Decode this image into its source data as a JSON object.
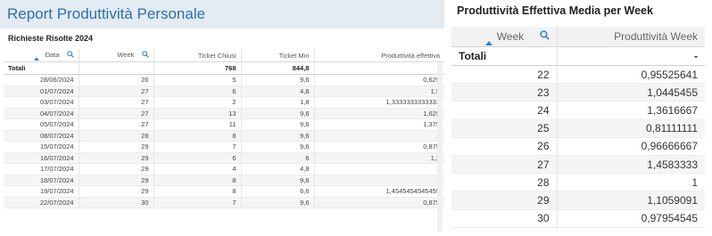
{
  "left_report": {
    "title": "Report Produttività Personale",
    "subtitle": "Richieste Risolte 2024",
    "columns": [
      "Data",
      "Week",
      "Ticket Chiusi",
      "Ticket Min",
      "Produttività effettiva"
    ],
    "totals": {
      "label": "Totali",
      "week": "",
      "ticket_chiusi": "768",
      "ticket_min": "844,8",
      "produttivita": "-"
    },
    "rows": [
      [
        "28/06/2024",
        "26",
        "5",
        "9,6",
        "0,625"
      ],
      [
        "01/07/2024",
        "27",
        "6",
        "4,8",
        "1,5"
      ],
      [
        "03/07/2024",
        "27",
        "2",
        "1,8",
        "1,3333333333333"
      ],
      [
        "04/07/2024",
        "27",
        "13",
        "9,6",
        "1,625"
      ],
      [
        "05/07/2024",
        "27",
        "11",
        "9,6",
        "1,375"
      ],
      [
        "08/07/2024",
        "28",
        "8",
        "9,6",
        "1"
      ],
      [
        "15/07/2024",
        "29",
        "7",
        "9,6",
        "0,875"
      ],
      [
        "16/07/2024",
        "29",
        "6",
        "6",
        "1,2"
      ],
      [
        "17/07/2024",
        "29",
        "4",
        "4,8",
        "1"
      ],
      [
        "18/07/2024",
        "29",
        "8",
        "9,6",
        "1"
      ],
      [
        "19/07/2024",
        "29",
        "8",
        "6,6",
        "1,4545454545455"
      ],
      [
        "22/07/2024",
        "30",
        "7",
        "9,6",
        "0,875"
      ]
    ],
    "icons": {
      "search": "search-icon",
      "sort": "sort-ascending-icon"
    },
    "colors": {
      "title": "#2f6fa8",
      "header_band": "#e3ebf3",
      "accent": "#3a82c4"
    }
  },
  "right_report": {
    "title": "Produttività Effettiva Media per Week",
    "columns": [
      "Week",
      "Produttività Week"
    ],
    "totals": {
      "label": "Totali",
      "value": "-"
    },
    "rows": [
      [
        "22",
        "0,95525641"
      ],
      [
        "23",
        "1,0445455"
      ],
      [
        "24",
        "1,3616667"
      ],
      [
        "25",
        "0,81111111"
      ],
      [
        "26",
        "0,96666667"
      ],
      [
        "27",
        "1,4583333"
      ],
      [
        "28",
        "1"
      ],
      [
        "29",
        "1,1059091"
      ],
      [
        "30",
        "0,97954545"
      ]
    ]
  }
}
